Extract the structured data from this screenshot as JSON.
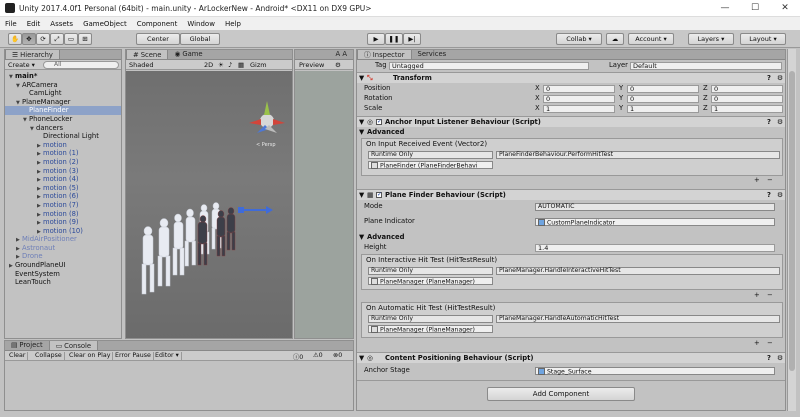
{
  "window": {
    "title": "Unity 2017.4.0f1 Personal (64bit) - main.unity - ArLockerNew - Android* <DX11 on DX9 GPU>"
  },
  "menu": [
    "File",
    "Edit",
    "Assets",
    "GameObject",
    "Component",
    "Window",
    "Help"
  ],
  "toolbar": {
    "center": "Center",
    "global": "Global",
    "collab": "Collab ▾",
    "account": "Account",
    "layers": "Layers",
    "layout": "Layout"
  },
  "hierarchy": {
    "tab": "Hierarchy",
    "create": "Create ▾",
    "search_placeholder": "All",
    "rows": [
      {
        "label": "main*",
        "indent": 0,
        "arrow": "▼",
        "style": "bold"
      },
      {
        "label": "ARCamera",
        "indent": 1,
        "arrow": "▼",
        "style": ""
      },
      {
        "label": "CamLight",
        "indent": 2,
        "arrow": "",
        "style": ""
      },
      {
        "label": "PlaneManager",
        "indent": 1,
        "arrow": "▼",
        "style": ""
      },
      {
        "label": "PlaneFinder",
        "indent": 2,
        "arrow": "",
        "style": "sel"
      },
      {
        "label": "PhoneLocker",
        "indent": 2,
        "arrow": "▼",
        "style": ""
      },
      {
        "label": "dancers",
        "indent": 3,
        "arrow": "▼",
        "style": ""
      },
      {
        "label": "Directional Light",
        "indent": 4,
        "arrow": "",
        "style": ""
      },
      {
        "label": "motion",
        "indent": 4,
        "arrow": "▶",
        "style": "prefab"
      },
      {
        "label": "motion (1)",
        "indent": 4,
        "arrow": "▶",
        "style": "prefab"
      },
      {
        "label": "motion (2)",
        "indent": 4,
        "arrow": "▶",
        "style": "prefab"
      },
      {
        "label": "motion (3)",
        "indent": 4,
        "arrow": "▶",
        "style": "prefab"
      },
      {
        "label": "motion (4)",
        "indent": 4,
        "arrow": "▶",
        "style": "prefab"
      },
      {
        "label": "motion (5)",
        "indent": 4,
        "arrow": "▶",
        "style": "prefab"
      },
      {
        "label": "motion (6)",
        "indent": 4,
        "arrow": "▶",
        "style": "prefab"
      },
      {
        "label": "motion (7)",
        "indent": 4,
        "arrow": "▶",
        "style": "prefab"
      },
      {
        "label": "motion (8)",
        "indent": 4,
        "arrow": "▶",
        "style": "prefab"
      },
      {
        "label": "motion (9)",
        "indent": 4,
        "arrow": "▶",
        "style": "prefab"
      },
      {
        "label": "motion (10)",
        "indent": 4,
        "arrow": "▶",
        "style": "prefab"
      },
      {
        "label": "MidAirPositioner",
        "indent": 1,
        "arrow": "▶",
        "style": "dim"
      },
      {
        "label": "Astronaut",
        "indent": 1,
        "arrow": "▶",
        "style": "dim"
      },
      {
        "label": "Drone",
        "indent": 1,
        "arrow": "▶",
        "style": "dim"
      },
      {
        "label": "GroundPlaneUI",
        "indent": 0,
        "arrow": "▶",
        "style": ""
      },
      {
        "label": "EventSystem",
        "indent": 0,
        "arrow": "",
        "style": ""
      },
      {
        "label": "LeanTouch",
        "indent": 0,
        "arrow": "",
        "style": ""
      }
    ]
  },
  "scene": {
    "tab": "Scene",
    "shading": "Shaded",
    "mode2d": "2D",
    "gizmos": "Gizm",
    "persp": "< Persp"
  },
  "game": {
    "tab": "Game",
    "preview": "Preview",
    "aa": "A A"
  },
  "inspector": {
    "tab": "Inspector",
    "tab2": "Services",
    "tag_label": "Tag",
    "tag_value": "Untagged",
    "layer_label": "Layer",
    "layer_value": "Default",
    "transform": {
      "title": "Transform",
      "rows": [
        {
          "label": "Position",
          "x": "0",
          "y": "0",
          "z": "0"
        },
        {
          "label": "Rotation",
          "x": "0",
          "y": "0",
          "z": "0"
        },
        {
          "label": "Scale",
          "x": "1",
          "y": "1",
          "z": "1"
        }
      ]
    },
    "anchor_listener": {
      "title": "Anchor Input Listener Behaviour (Script)",
      "advanced": "Advanced",
      "event_title": "On Input Received Event (Vector2)",
      "runtime": "Runtime Only",
      "function": "PlaneFinderBehaviour.PerformHitTest",
      "object": "PlaneFinder (PlaneFinderBehavi"
    },
    "plane_finder": {
      "title": "Plane Finder Behaviour (Script)",
      "mode_label": "Mode",
      "mode_value": "AUTOMATIC",
      "indicator_label": "Plane Indicator",
      "indicator_value": "CustomPlaneIndicator",
      "advanced": "Advanced",
      "height_label": "Height",
      "height_value": "1.4",
      "interactive_title": "On Interactive Hit Test (HitTestResult)",
      "interactive_runtime": "Runtime Only",
      "interactive_function": "PlaneManager.HandleInteractiveHitTest",
      "interactive_object": "PlaneManager (PlaneManager)",
      "automatic_title": "On Automatic Hit Test (HitTestResult)",
      "automatic_runtime": "Runtime Only",
      "automatic_function": "PlaneManager.HandleAutomaticHitTest",
      "automatic_object": "PlaneManager (PlaneManager)"
    },
    "content_positioning": {
      "title": "Content Positioning Behaviour (Script)",
      "anchor_label": "Anchor Stage",
      "anchor_value": "Stage_Surface"
    },
    "add_component": "Add Component"
  },
  "console": {
    "tab1": "Project",
    "tab2": "Console",
    "buttons": [
      "Clear",
      "Collapse",
      "Clear on Play",
      "Error Pause",
      "Editor ▾"
    ],
    "counts": [
      "0",
      "0",
      "0"
    ]
  }
}
